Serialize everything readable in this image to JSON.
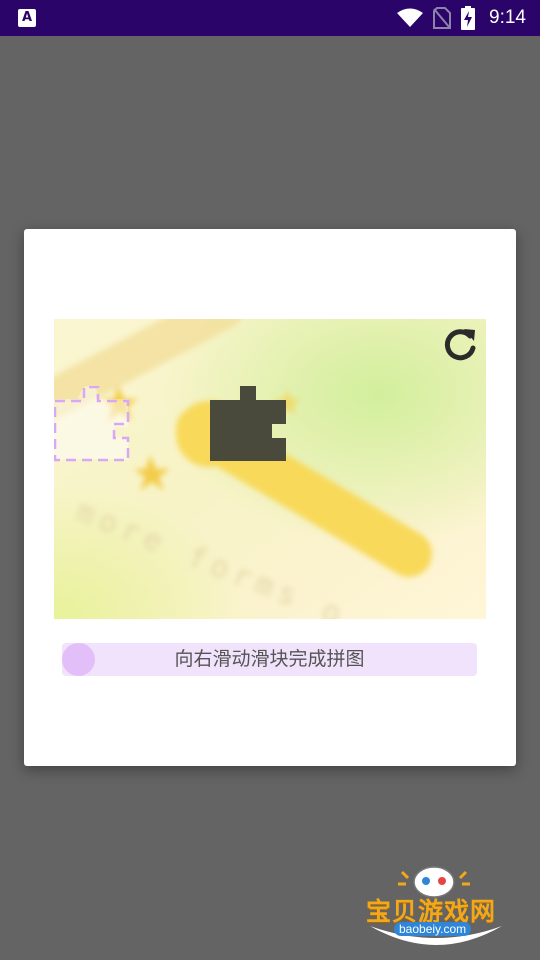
{
  "status_bar": {
    "app_icon_letter": "A",
    "time": "9:14",
    "icons": [
      "wifi-icon",
      "no-sim-icon",
      "battery-charging-icon"
    ]
  },
  "captcha": {
    "refresh_icon": "refresh-icon",
    "slider_label": "向右滑动滑块完成拼图",
    "background_text": "more forms o",
    "colors": {
      "slider_track": "#f1e3fb",
      "slider_knob": "#e2bff8",
      "dark_piece": "#4a4a3c",
      "piece_outline": "#d6a8f5"
    }
  },
  "watermark": {
    "brand": "宝贝游戏网",
    "url": "baobeiy.com"
  }
}
